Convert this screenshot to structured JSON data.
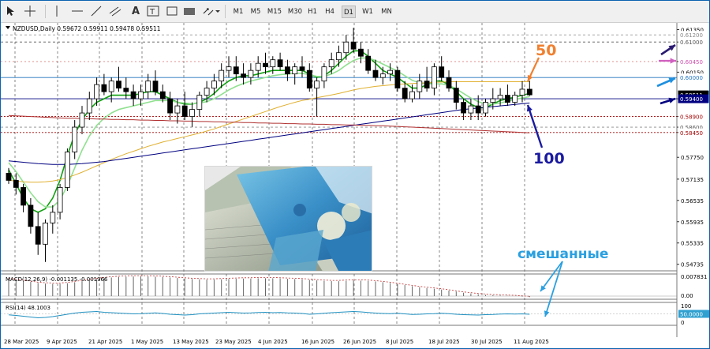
{
  "toolbar": {
    "tools": [
      "cursor-icon",
      "crosshair-icon",
      "vertical-line-icon",
      "horizontal-line-icon",
      "trendline-icon",
      "channel-icon",
      "text-icon",
      "label-icon",
      "rectangle-icon",
      "shapes-icon"
    ],
    "timeframes": [
      "M1",
      "M5",
      "M15",
      "M30",
      "H1",
      "H4",
      "D1",
      "W1",
      "MN"
    ],
    "active_timeframe": "D1"
  },
  "chart_data": {
    "type": "candlestick",
    "symbol_header": "NZDUSD,Daily  0.59672 0.59911 0.59478 0.59511",
    "x_labels": [
      "28 Mar 2025",
      "9 Apr 2025",
      "21 Apr 2025",
      "1 May 2025",
      "13 May 2025",
      "23 May 2025",
      "4 Jun 2025",
      "16 Jun 2025",
      "26 Jun 2025",
      "8 Jul 2025",
      "18 Jul 2025",
      "30 Jul 2025",
      "11 Aug 2025"
    ],
    "y_ticks": [
      0.6135,
      0.61,
      0.6045,
      0.6015,
      0.594,
      0.589,
      0.586,
      0.5845,
      0.5775,
      0.57135,
      0.56535,
      0.55935,
      0.55335,
      0.54735
    ],
    "ylim": [
      0.5455,
      0.6145
    ],
    "price_labels": [
      {
        "value": 0.612,
        "text": "0.61200",
        "bg": "#ffffff",
        "fg": "#888888"
      },
      {
        "value": 0.61,
        "text": "0.61000",
        "bg": "#ffffff",
        "fg": "#555555"
      },
      {
        "value": 0.6045,
        "text": "0.60450",
        "bg": "#ffffff",
        "fg": "#d04fb0"
      },
      {
        "value": 0.6,
        "text": "0.60000",
        "bg": "#ffffff",
        "fg": "#1e73be"
      },
      {
        "value": 0.59511,
        "text": "0.59511",
        "bg": "#000000",
        "fg": "#ffffff"
      },
      {
        "value": 0.594,
        "text": "0.59400",
        "bg": "#000080",
        "fg": "#ffffff"
      },
      {
        "value": 0.589,
        "text": "0.58900",
        "bg": "#ffffff",
        "fg": "#a00000"
      },
      {
        "value": 0.586,
        "text": "0.58600",
        "bg": "#ffffff",
        "fg": "#555555"
      },
      {
        "value": 0.5845,
        "text": "0.58450",
        "bg": "#ffffff",
        "fg": "#a00000"
      }
    ],
    "candles": [
      [
        0.573,
        0.5745,
        0.57,
        0.571
      ],
      [
        0.571,
        0.573,
        0.567,
        0.569
      ],
      [
        0.569,
        0.57,
        0.562,
        0.564
      ],
      [
        0.564,
        0.566,
        0.556,
        0.558
      ],
      [
        0.558,
        0.562,
        0.55,
        0.553
      ],
      [
        0.553,
        0.56,
        0.548,
        0.559
      ],
      [
        0.559,
        0.564,
        0.556,
        0.562
      ],
      [
        0.562,
        0.57,
        0.56,
        0.569
      ],
      [
        0.569,
        0.58,
        0.568,
        0.579
      ],
      [
        0.579,
        0.588,
        0.577,
        0.586
      ],
      [
        0.586,
        0.592,
        0.584,
        0.59
      ],
      [
        0.59,
        0.596,
        0.588,
        0.594
      ],
      [
        0.594,
        0.6,
        0.592,
        0.598
      ],
      [
        0.598,
        0.601,
        0.595,
        0.596
      ],
      [
        0.596,
        0.6,
        0.593,
        0.599
      ],
      [
        0.599,
        0.603,
        0.596,
        0.597
      ],
      [
        0.597,
        0.6,
        0.594,
        0.596
      ],
      [
        0.596,
        0.598,
        0.592,
        0.594
      ],
      [
        0.594,
        0.598,
        0.592,
        0.596
      ],
      [
        0.596,
        0.601,
        0.594,
        0.599
      ],
      [
        0.599,
        0.602,
        0.595,
        0.596
      ],
      [
        0.596,
        0.598,
        0.593,
        0.594
      ],
      [
        0.594,
        0.596,
        0.588,
        0.59
      ],
      [
        0.59,
        0.594,
        0.587,
        0.592
      ],
      [
        0.592,
        0.596,
        0.588,
        0.589
      ],
      [
        0.589,
        0.593,
        0.586,
        0.591
      ],
      [
        0.591,
        0.596,
        0.589,
        0.595
      ],
      [
        0.595,
        0.599,
        0.593,
        0.597
      ],
      [
        0.597,
        0.601,
        0.595,
        0.599
      ],
      [
        0.599,
        0.604,
        0.597,
        0.602
      ],
      [
        0.602,
        0.606,
        0.6,
        0.603
      ],
      [
        0.603,
        0.606,
        0.599,
        0.601
      ],
      [
        0.601,
        0.604,
        0.598,
        0.6
      ],
      [
        0.6,
        0.604,
        0.598,
        0.602
      ],
      [
        0.602,
        0.606,
        0.6,
        0.604
      ],
      [
        0.604,
        0.607,
        0.601,
        0.603
      ],
      [
        0.603,
        0.606,
        0.601,
        0.605
      ],
      [
        0.605,
        0.607,
        0.602,
        0.603
      ],
      [
        0.603,
        0.605,
        0.599,
        0.601
      ],
      [
        0.601,
        0.604,
        0.598,
        0.603
      ],
      [
        0.603,
        0.606,
        0.6,
        0.602
      ],
      [
        0.602,
        0.604,
        0.596,
        0.597
      ],
      [
        0.597,
        0.6,
        0.589,
        0.599
      ],
      [
        0.599,
        0.604,
        0.597,
        0.603
      ],
      [
        0.603,
        0.607,
        0.601,
        0.605
      ],
      [
        0.605,
        0.609,
        0.603,
        0.607
      ],
      [
        0.607,
        0.612,
        0.605,
        0.61
      ],
      [
        0.61,
        0.614,
        0.607,
        0.608
      ],
      [
        0.608,
        0.61,
        0.604,
        0.606
      ],
      [
        0.606,
        0.608,
        0.601,
        0.602
      ],
      [
        0.602,
        0.605,
        0.599,
        0.6
      ],
      [
        0.6,
        0.603,
        0.598,
        0.601
      ],
      [
        0.601,
        0.604,
        0.599,
        0.602
      ],
      [
        0.602,
        0.603,
        0.596,
        0.597
      ],
      [
        0.597,
        0.599,
        0.593,
        0.594
      ],
      [
        0.594,
        0.598,
        0.593,
        0.596
      ],
      [
        0.596,
        0.601,
        0.594,
        0.599
      ],
      [
        0.599,
        0.603,
        0.596,
        0.597
      ],
      [
        0.597,
        0.604,
        0.595,
        0.603
      ],
      [
        0.603,
        0.606,
        0.599,
        0.6
      ],
      [
        0.6,
        0.602,
        0.596,
        0.597
      ],
      [
        0.597,
        0.599,
        0.591,
        0.593
      ],
      [
        0.593,
        0.594,
        0.588,
        0.59
      ],
      [
        0.59,
        0.594,
        0.588,
        0.592
      ],
      [
        0.592,
        0.595,
        0.588,
        0.59
      ],
      [
        0.59,
        0.594,
        0.589,
        0.593
      ],
      [
        0.593,
        0.597,
        0.591,
        0.594
      ],
      [
        0.594,
        0.597,
        0.592,
        0.595
      ],
      [
        0.595,
        0.598,
        0.592,
        0.593
      ],
      [
        0.593,
        0.596,
        0.592,
        0.595
      ],
      [
        0.595,
        0.599,
        0.593,
        0.5967
      ],
      [
        0.5967,
        0.5991,
        0.5948,
        0.5951
      ]
    ],
    "moving_averages": [
      {
        "color": "#10a010",
        "values": [
          0.574,
          0.57,
          0.566,
          0.563,
          0.562,
          0.563,
          0.566,
          0.571,
          0.578,
          0.584,
          0.588,
          0.591,
          0.593,
          0.594,
          0.595,
          0.595,
          0.595,
          0.595,
          0.5955,
          0.596,
          0.596,
          0.595,
          0.594,
          0.593,
          0.5925,
          0.5925,
          0.593,
          0.594,
          0.5955,
          0.5975,
          0.599,
          0.6,
          0.6005,
          0.6005,
          0.601,
          0.6015,
          0.602,
          0.602,
          0.602,
          0.602,
          0.602,
          0.601,
          0.6,
          0.6005,
          0.602,
          0.604,
          0.606,
          0.6075,
          0.6075,
          0.606,
          0.604,
          0.602,
          0.601,
          0.6,
          0.5985,
          0.597,
          0.597,
          0.598,
          0.599,
          0.599,
          0.598,
          0.596,
          0.594,
          0.5925,
          0.5915,
          0.5915,
          0.5925,
          0.5935,
          0.594,
          0.5945,
          0.595,
          0.5955
        ]
      },
      {
        "color": "#90e090",
        "values": [
          0.576,
          0.5735,
          0.5705,
          0.5675,
          0.565,
          0.5635,
          0.5635,
          0.5655,
          0.5695,
          0.5745,
          0.5795,
          0.5835,
          0.5865,
          0.5885,
          0.59,
          0.591,
          0.5915,
          0.592,
          0.5925,
          0.593,
          0.5935,
          0.5935,
          0.5935,
          0.593,
          0.5928,
          0.5926,
          0.5928,
          0.5932,
          0.594,
          0.5952,
          0.5965,
          0.5975,
          0.5983,
          0.599,
          0.5995,
          0.6,
          0.6005,
          0.6008,
          0.601,
          0.6012,
          0.6012,
          0.6008,
          0.6003,
          0.6003,
          0.601,
          0.602,
          0.6035,
          0.6048,
          0.6055,
          0.6055,
          0.6048,
          0.6038,
          0.6028,
          0.6018,
          0.6005,
          0.5992,
          0.5985,
          0.5982,
          0.5982,
          0.5982,
          0.5978,
          0.5968,
          0.5955,
          0.5942,
          0.5932,
          0.5925,
          0.5925,
          0.5928,
          0.5933,
          0.5938,
          0.5942,
          0.5946
        ]
      },
      {
        "color": "#e0b030",
        "values": [
          0.571,
          0.5708,
          0.5706,
          0.5705,
          0.5705,
          0.5706,
          0.5708,
          0.5712,
          0.5718,
          0.5725,
          0.5733,
          0.5742,
          0.5751,
          0.576,
          0.5769,
          0.5777,
          0.5785,
          0.5792,
          0.5799,
          0.5806,
          0.5812,
          0.5818,
          0.5823,
          0.5828,
          0.5833,
          0.5838,
          0.5843,
          0.5849,
          0.5855,
          0.5862,
          0.5869,
          0.5876,
          0.5883,
          0.589,
          0.5897,
          0.5904,
          0.5911,
          0.5918,
          0.5924,
          0.593,
          0.5935,
          0.5939,
          0.5943,
          0.5947,
          0.5951,
          0.5955,
          0.596,
          0.5965,
          0.5969,
          0.5972,
          0.5975,
          0.5977,
          0.5979,
          0.5981,
          0.5982,
          0.5983,
          0.5984,
          0.5985,
          0.5986,
          0.5987,
          0.5988,
          0.5988,
          0.5988,
          0.5988,
          0.5988,
          0.5988,
          0.5988,
          0.5988,
          0.5988,
          0.5988,
          0.5988,
          0.5988
        ]
      },
      {
        "color": "#000080",
        "values": [
          0.5765,
          0.5763,
          0.5761,
          0.5759,
          0.5757,
          0.5756,
          0.5755,
          0.5755,
          0.5755,
          0.5756,
          0.5757,
          0.5759,
          0.5761,
          0.5763,
          0.5766,
          0.5769,
          0.5772,
          0.5775,
          0.5778,
          0.5781,
          0.5784,
          0.5787,
          0.579,
          0.5793,
          0.5796,
          0.5799,
          0.5802,
          0.5805,
          0.5808,
          0.5811,
          0.5814,
          0.5817,
          0.582,
          0.5823,
          0.5826,
          0.5829,
          0.5832,
          0.5835,
          0.5838,
          0.5841,
          0.5844,
          0.5847,
          0.585,
          0.5853,
          0.5856,
          0.5859,
          0.5862,
          0.5865,
          0.5868,
          0.5871,
          0.5874,
          0.5877,
          0.588,
          0.5883,
          0.5886,
          0.5889,
          0.5892,
          0.5895,
          0.5898,
          0.5901,
          0.5904,
          0.5907,
          0.591,
          0.5912,
          0.5914,
          0.5916,
          0.5918,
          0.592,
          0.5922,
          0.5924,
          0.5926,
          0.5928
        ]
      },
      {
        "color": "#b03030",
        "values": [
          0.5893,
          0.5892,
          0.5891,
          0.589,
          0.5889,
          0.5888,
          0.5887,
          0.5886,
          0.5885,
          0.5885,
          0.5884,
          0.5884,
          0.5883,
          0.5883,
          0.5882,
          0.5882,
          0.5881,
          0.5881,
          0.588,
          0.588,
          0.5879,
          0.5879,
          0.5878,
          0.5878,
          0.5877,
          0.5877,
          0.5876,
          0.5876,
          0.5875,
          0.5875,
          0.5874,
          0.5874,
          0.5873,
          0.5873,
          0.5872,
          0.5872,
          0.5871,
          0.5871,
          0.587,
          0.587,
          0.5869,
          0.5869,
          0.5868,
          0.5868,
          0.5867,
          0.5867,
          0.5866,
          0.5866,
          0.5865,
          0.5865,
          0.5864,
          0.5864,
          0.5863,
          0.5862,
          0.5861,
          0.586,
          0.5859,
          0.5858,
          0.5857,
          0.5856,
          0.5855,
          0.5854,
          0.5853,
          0.5852,
          0.5851,
          0.585,
          0.5849,
          0.5848,
          0.5847,
          0.5846,
          0.5845,
          0.5844
        ]
      }
    ],
    "horizontal_levels": [
      {
        "value": 0.612,
        "color": "#9a9a9a",
        "dash": "3,3"
      },
      {
        "value": 0.61,
        "color": "#555555",
        "dash": "3,3"
      },
      {
        "value": 0.6045,
        "color": "#e08080",
        "dash": "2,3"
      },
      {
        "value": 0.6,
        "color": "#1e73be",
        "dash": ""
      },
      {
        "value": 0.594,
        "color": "#000080",
        "dash": ""
      },
      {
        "value": 0.589,
        "color": "#a00000",
        "dash": "2,2"
      },
      {
        "value": 0.586,
        "color": "#888888",
        "dash": "3,3"
      },
      {
        "value": 0.5845,
        "color": "#a00000",
        "dash": "2,2"
      }
    ],
    "annotations": [
      {
        "text": "50",
        "color": "#f08030"
      },
      {
        "text": "100",
        "color": "#1a1aa0"
      },
      {
        "text": "смешанные",
        "color": "#2aa0e0"
      }
    ],
    "macd": {
      "label": "MACD(12,26,9) -0.001135 -0.001966",
      "ticks": [
        "0.007831",
        "0.00"
      ],
      "histogram": [
        0.0065,
        0.0062,
        0.0058,
        0.0054,
        0.005,
        0.0048,
        0.0047,
        0.0047,
        0.0049,
        0.0053,
        0.0057,
        0.0061,
        0.0065,
        0.0068,
        0.0071,
        0.0073,
        0.0074,
        0.0075,
        0.0075,
        0.0075,
        0.0074,
        0.0073,
        0.0071,
        0.0069,
        0.0067,
        0.0065,
        0.0064,
        0.0063,
        0.0063,
        0.0064,
        0.0065,
        0.0066,
        0.0067,
        0.0067,
        0.0068,
        0.0068,
        0.0068,
        0.0067,
        0.0066,
        0.0065,
        0.0064,
        0.0062,
        0.006,
        0.0058,
        0.0057,
        0.0057,
        0.0058,
        0.0059,
        0.0059,
        0.0058,
        0.0056,
        0.0053,
        0.005,
        0.0046,
        0.0042,
        0.0038,
        0.0034,
        0.0031,
        0.0028,
        0.0025,
        0.0021,
        0.0017,
        0.0013,
        0.001,
        0.0007,
        0.0005,
        0.0003,
        0.0002,
        0.0001,
        0.0,
        -0.0002,
        -0.0004
      ]
    },
    "rsi": {
      "label": "RSI(14) 48.1003",
      "ticks": [
        "100",
        "50.0000",
        "0"
      ],
      "values": [
        45,
        42,
        38,
        34,
        30,
        32,
        36,
        42,
        48,
        54,
        58,
        60,
        62,
        58,
        56,
        54,
        52,
        50,
        51,
        53,
        55,
        52,
        48,
        46,
        44,
        46,
        50,
        52,
        54,
        56,
        58,
        56,
        54,
        55,
        57,
        58,
        56,
        57,
        55,
        54,
        52,
        48,
        50,
        53,
        56,
        58,
        60,
        62,
        60,
        57,
        54,
        52,
        51,
        53,
        50,
        47,
        48,
        50,
        51,
        53,
        51,
        48,
        46,
        45,
        44,
        46,
        47,
        49,
        50,
        49,
        50,
        48
      ]
    }
  }
}
